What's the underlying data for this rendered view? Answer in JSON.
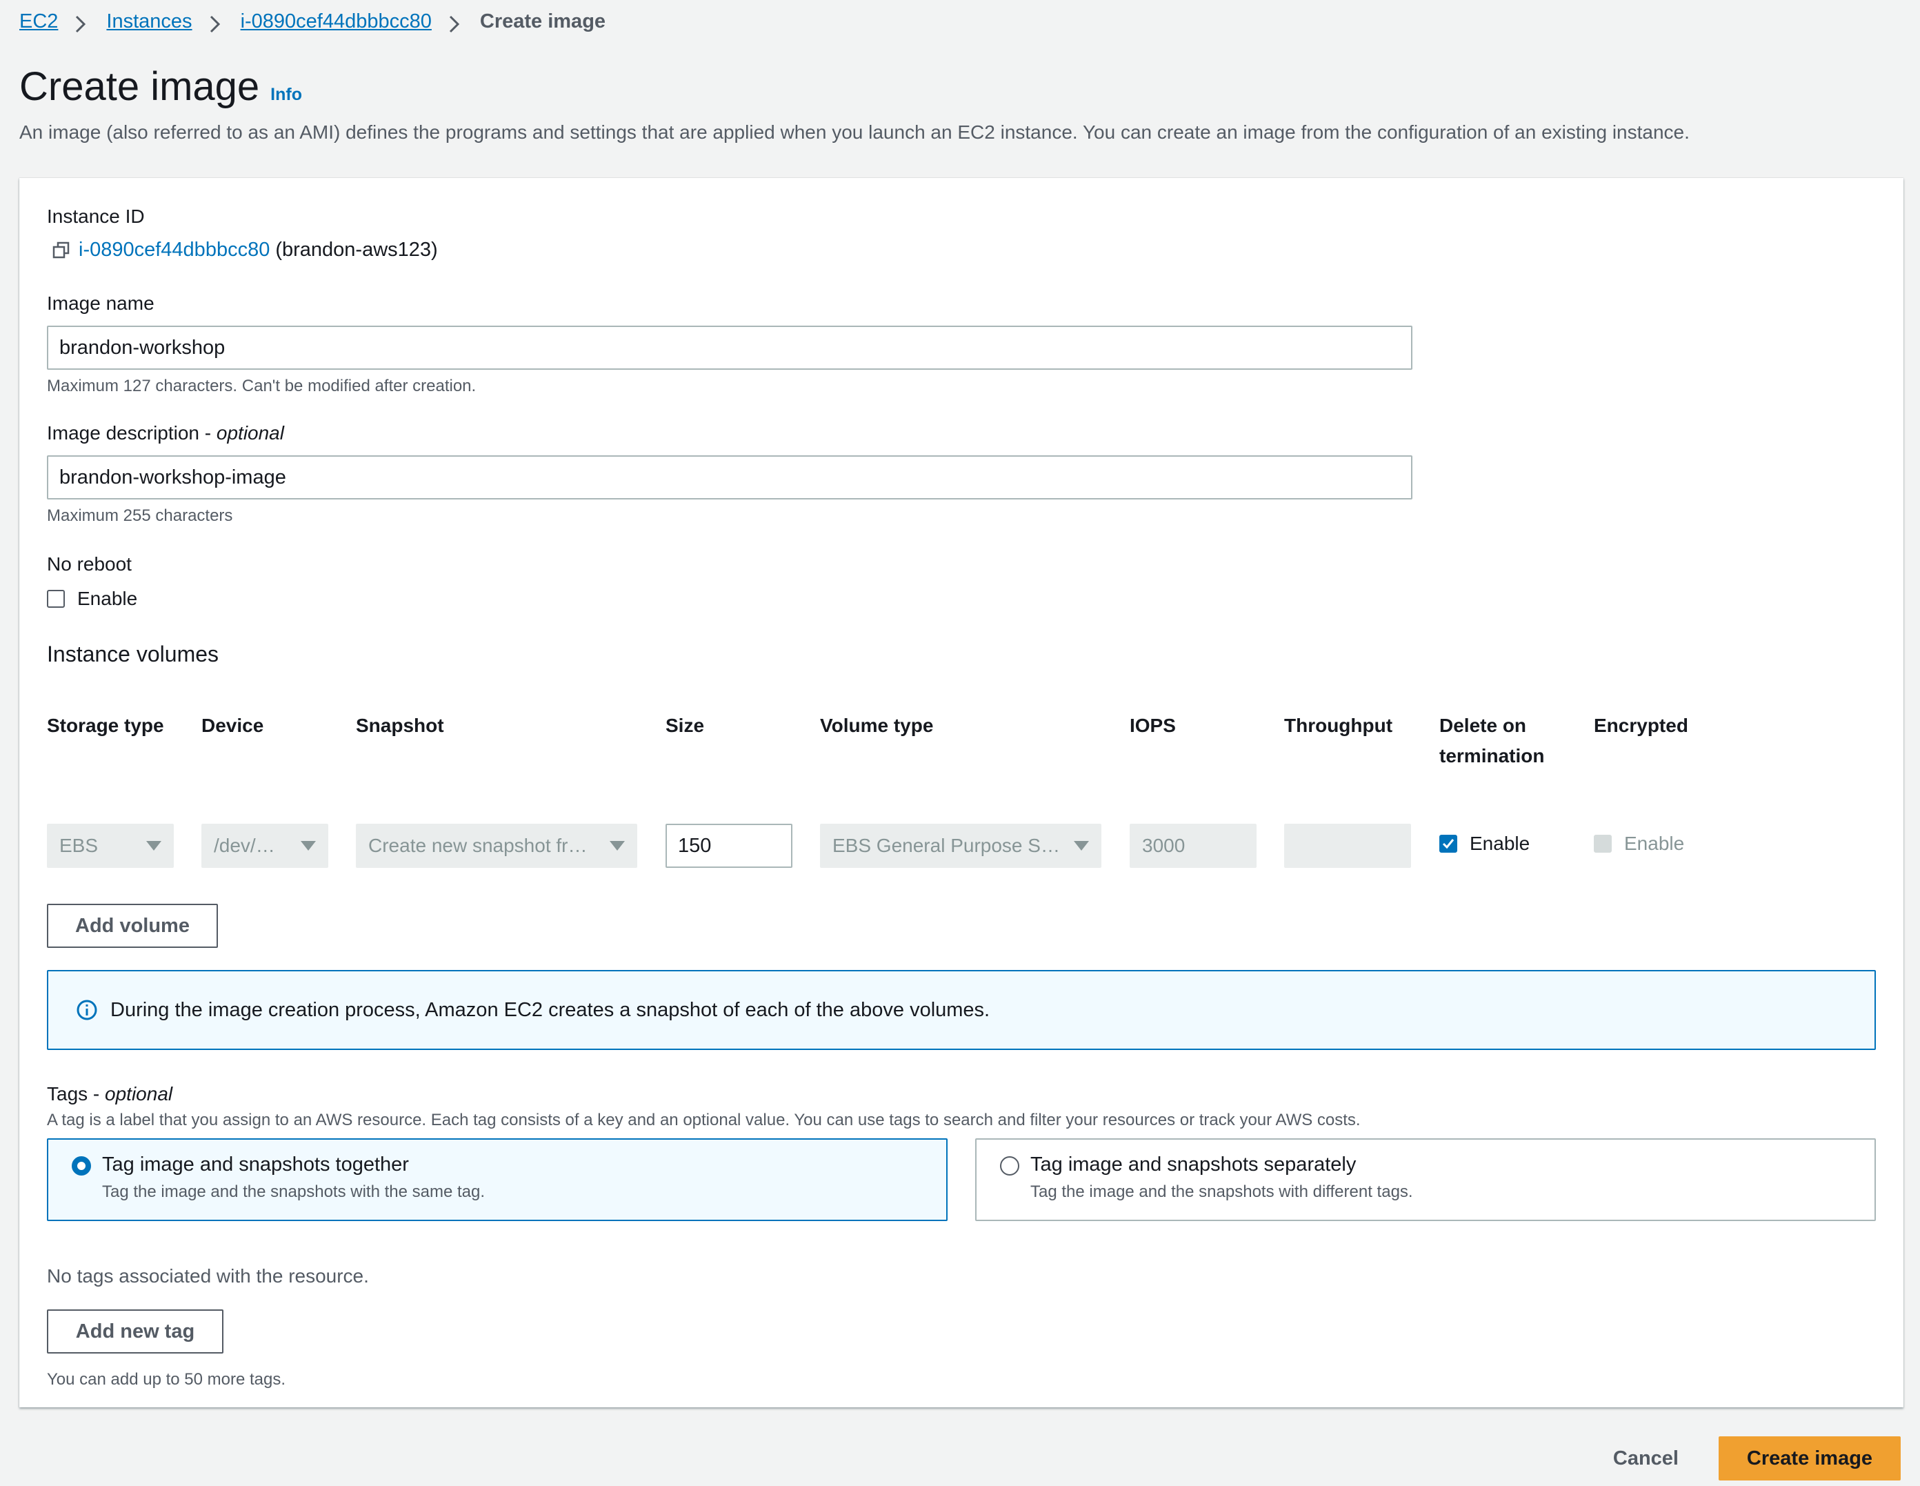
{
  "breadcrumb": {
    "items": [
      "EC2",
      "Instances",
      "i-0890cef44dbbbcc80"
    ],
    "current": "Create image"
  },
  "header": {
    "title": "Create image",
    "info_link": "Info",
    "description": "An image (also referred to as an AMI) defines the programs and settings that are applied when you launch an EC2 instance. You can create an image from the configuration of an existing instance."
  },
  "instance": {
    "label": "Instance ID",
    "id": "i-0890cef44dbbbcc80",
    "name": "(brandon-aws123)"
  },
  "image_name": {
    "label": "Image name",
    "value": "brandon-workshop",
    "constraint": "Maximum 127 characters. Can't be modified after creation."
  },
  "image_description": {
    "label": "Image description - ",
    "label_optional": "optional",
    "value": "brandon-workshop-image",
    "constraint": "Maximum 255 characters"
  },
  "no_reboot": {
    "label": "No reboot",
    "checkbox_label": "Enable",
    "checked": false
  },
  "volumes": {
    "heading": "Instance volumes",
    "columns": [
      "Storage type",
      "Device",
      "Snapshot",
      "Size",
      "Volume type",
      "IOPS",
      "Throughput",
      "Delete on termination",
      "Encrypted"
    ],
    "row": {
      "storage_type": "EBS",
      "device": "/dev/…",
      "snapshot": "Create new snapshot fr…",
      "size": "150",
      "volume_type": "EBS General Purpose S…",
      "iops": "3000",
      "throughput": "",
      "delete_on_termination": "Enable",
      "encrypted": "Enable"
    },
    "add_button": "Add volume"
  },
  "alert": {
    "text": "During the image creation process, Amazon EC2 creates a snapshot of each of the above volumes."
  },
  "tags": {
    "label": "Tags - ",
    "label_optional": "optional",
    "description": "A tag is a label that you assign to an AWS resource. Each tag consists of a key and an optional value. You can use tags to search and filter your resources or track your AWS costs.",
    "options": [
      {
        "title": "Tag image and snapshots together",
        "desc": "Tag the image and the snapshots with the same tag.",
        "selected": true
      },
      {
        "title": "Tag image and snapshots separately",
        "desc": "Tag the image and the snapshots with different tags.",
        "selected": false
      }
    ],
    "empty_text": "No tags associated with the resource.",
    "add_button": "Add new tag",
    "limit_text": "You can add up to 50 more tags."
  },
  "footer": {
    "cancel": "Cancel",
    "submit": "Create image"
  },
  "colors": {
    "link": "#0073bb",
    "primary_button": "#f0a030",
    "background": "#f2f3f3",
    "alert_bg": "#f1faff"
  }
}
